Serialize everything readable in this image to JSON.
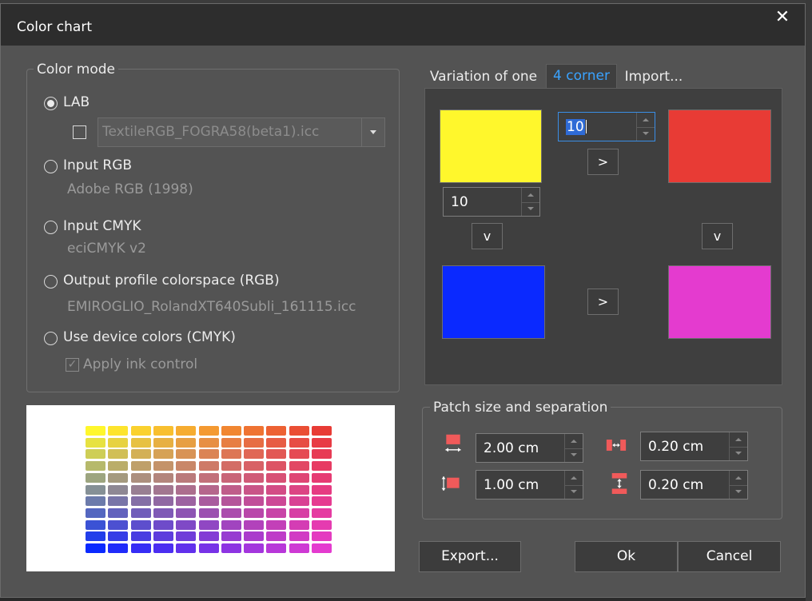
{
  "dialog": {
    "title": "Color chart",
    "close_glyph": "✕"
  },
  "color_mode": {
    "legend": "Color mode",
    "options": [
      {
        "label": "LAB",
        "selected": true
      },
      {
        "label": "Input RGB",
        "selected": false,
        "sub": "Adobe RGB (1998)"
      },
      {
        "label": "Input CMYK",
        "selected": false,
        "sub": "eciCMYK v2"
      },
      {
        "label": "Output profile colorspace (RGB)",
        "selected": false,
        "sub": "EMIROGLIO_RolandXT640Subli_161115.icc"
      },
      {
        "label": "Use device colors (CMYK)",
        "selected": false
      }
    ],
    "lab_profile": {
      "checked": false,
      "value": "TextileRGB_FOGRA58(beta1).icc"
    },
    "apply_ink_control": {
      "label": "Apply ink control",
      "checked": true,
      "disabled": true
    }
  },
  "tabs": [
    {
      "label": "Variation of one",
      "active": false
    },
    {
      "label": "4 corner",
      "active": true
    },
    {
      "label": "Import...",
      "active": false
    }
  ],
  "corner": {
    "horizontal_steps": "10",
    "vertical_steps": "10",
    "right_label": ">",
    "down_label": "v",
    "colors": {
      "top_left": "#fff72c",
      "top_right": "#e83b35",
      "bottom_left": "#0a29ff",
      "bottom_right": "#e43bcf"
    }
  },
  "patch": {
    "legend": "Patch size and separation",
    "width": "2.00 cm",
    "height": "1.00 cm",
    "h_separation": "0.20 cm",
    "v_separation": "0.20 cm",
    "icons": [
      "patch-width-icon",
      "patch-height-icon",
      "horizontal-gap-icon",
      "vertical-gap-icon"
    ],
    "icon_color": "#f05a5a"
  },
  "preview": {
    "columns": 11,
    "rows": 11
  },
  "buttons": {
    "export": "Export...",
    "ok": "Ok",
    "cancel": "Cancel"
  }
}
